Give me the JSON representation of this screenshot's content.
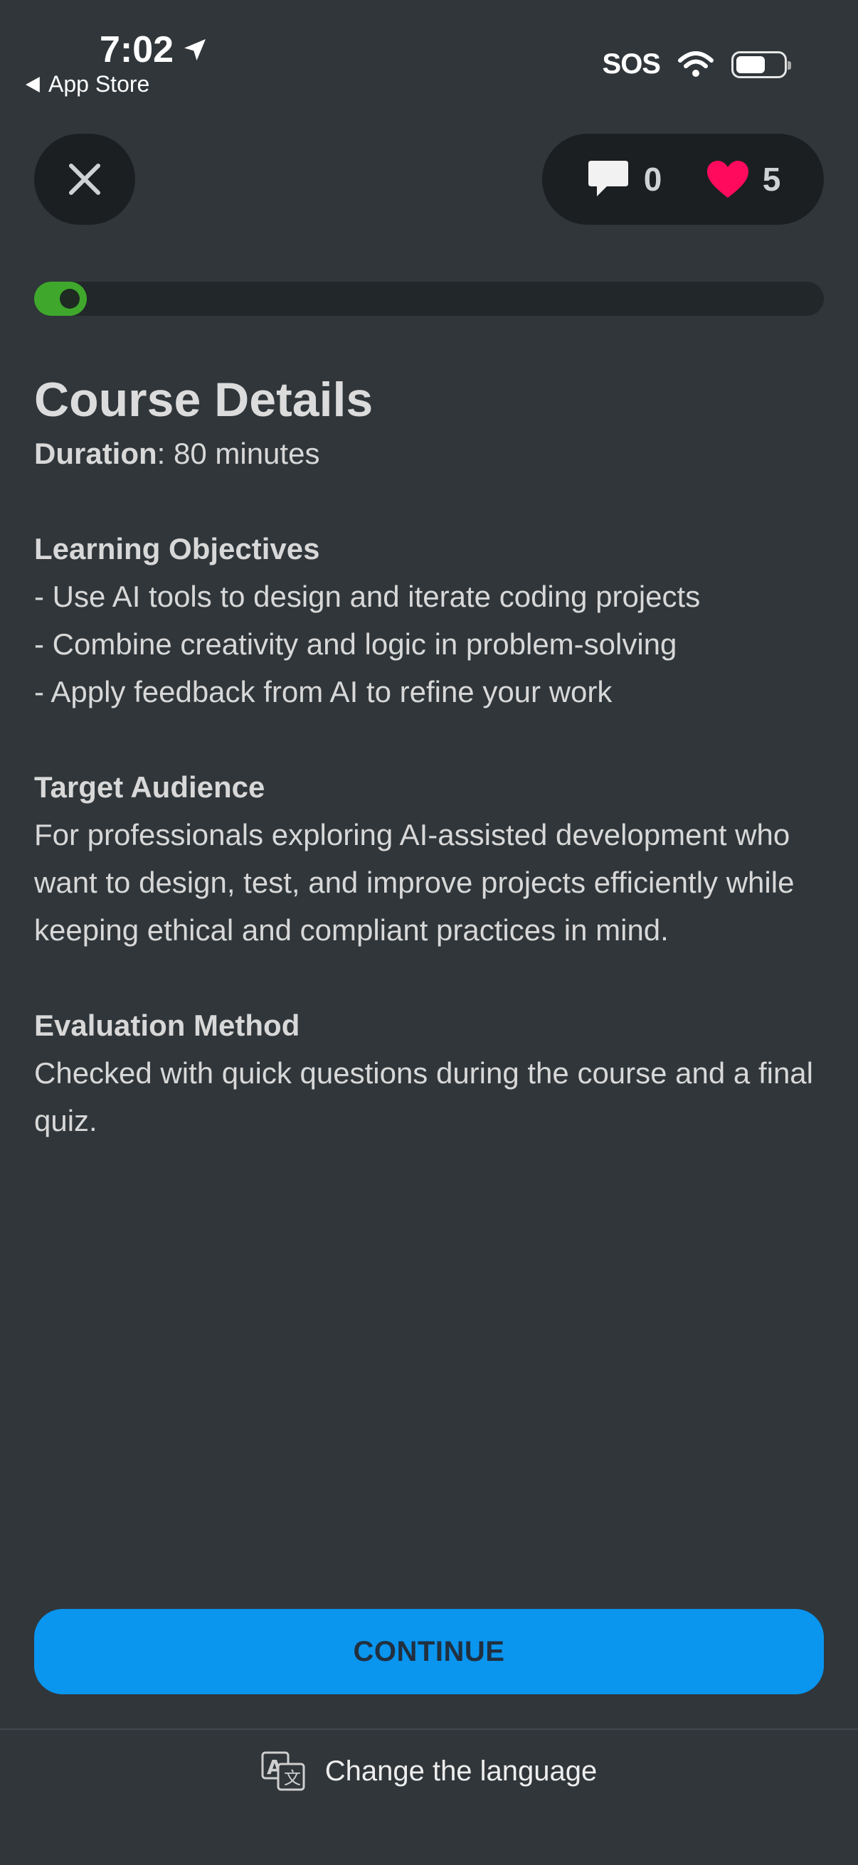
{
  "status_bar": {
    "time": "7:02",
    "back_label": "App Store",
    "sos": "SOS"
  },
  "header": {
    "comments_count": "0",
    "hearts_count": "5"
  },
  "progress": {
    "value": 0.04
  },
  "course": {
    "title": "Course Details",
    "duration_label": "Duration",
    "duration_value": ": 80 minutes",
    "objectives_heading": "Learning Objectives",
    "objectives": [
      "- Use AI tools to design and iterate coding projects",
      "- Combine creativity and logic in problem-solving",
      "- Apply feedback from AI to refine your work"
    ],
    "audience_heading": "Target Audience",
    "audience_text": "For professionals exploring AI-assisted development who want to design, test, and improve projects efficiently while keeping ethical and compliant practices in mind.",
    "evaluation_heading": "Evaluation Method",
    "evaluation_text": "Checked with quick questions during the course and a final quiz."
  },
  "footer": {
    "continue_label": "CONTINUE",
    "language_label": "Change the language"
  },
  "colors": {
    "background": "#30363a",
    "progress": "#3fa82c",
    "heart": "#ff0a5c",
    "continue": "#0a95ef"
  }
}
